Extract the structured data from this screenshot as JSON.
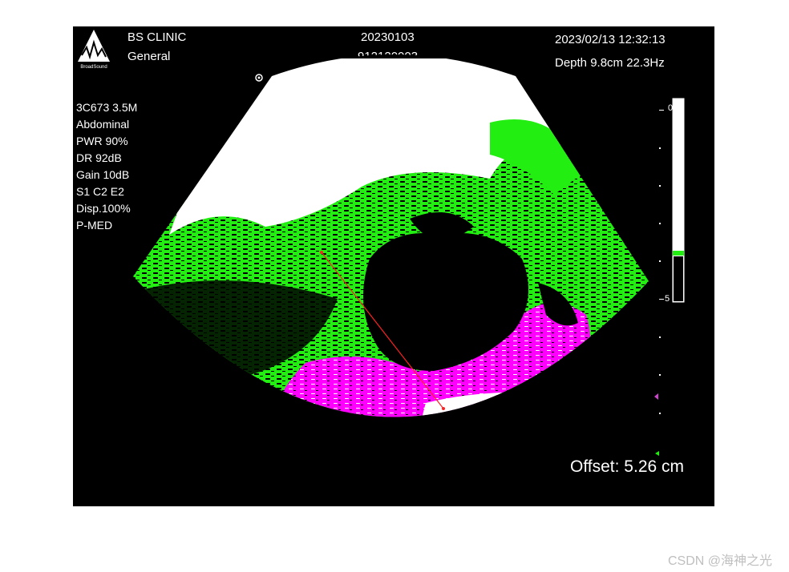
{
  "header": {
    "clinic": "BS CLINIC",
    "department": "General",
    "study_date": "20230103",
    "patient_id": "912120003",
    "datetime": "2023/02/13  12:32:13",
    "depth_freq": "Depth 9.8cm  22.3Hz",
    "logo_text": "BroadSound"
  },
  "params": [
    "3C673 3.5M",
    "Abdominal",
    "PWR 90%",
    "DR 92dB",
    "Gain 10dB",
    "S1 C2 E2",
    "Disp.100%",
    "P-MED"
  ],
  "scale": {
    "top_label": "0",
    "bottom_label": "5"
  },
  "measurement": {
    "offset_text": "Offset: 5.26 cm"
  },
  "watermark": "CSDN @海神之光",
  "colors": {
    "tissue_green": "#22ee11",
    "tissue_magenta": "#ff00ff",
    "tissue_white": "#ffffff",
    "background": "#000000",
    "caliper": "#ff2222"
  },
  "icons": [
    "broadsound-logo-icon",
    "focus-marker-icon",
    "caliper-line-icon"
  ]
}
